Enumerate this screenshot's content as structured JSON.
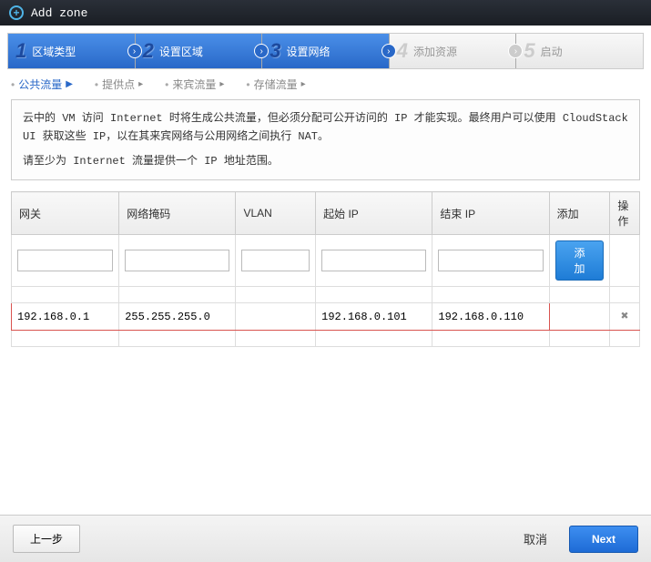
{
  "title": "Add zone",
  "steps": [
    {
      "num": "1",
      "label": "区域类型",
      "active": true
    },
    {
      "num": "2",
      "label": "设置区域",
      "active": true
    },
    {
      "num": "3",
      "label": "设置网络",
      "active": true
    },
    {
      "num": "4",
      "label": "添加资源",
      "active": false
    },
    {
      "num": "5",
      "label": "启动",
      "active": false
    }
  ],
  "subnav": {
    "public": "公共流量",
    "pod": "提供点",
    "guest": "来宾流量",
    "storage": "存储流量"
  },
  "info_line1": "云中的 VM 访问 Internet 时将生成公共流量，但必须分配可公开访问的 IP 才能实现。最终用户可以使用 CloudStack UI 获取这些 IP，以在其来宾网络与公用网络之间执行 NAT。",
  "info_line2": "请至少为 Internet 流量提供一个 IP 地址范围。",
  "headers": {
    "gateway": "网关",
    "netmask": "网络掩码",
    "vlan": "VLAN",
    "startip": "起始 IP",
    "endip": "结束 IP",
    "add": "添加",
    "ops": "操作"
  },
  "add_btn": "添加",
  "row": {
    "gateway": "192.168.0.1",
    "netmask": "255.255.255.0",
    "vlan": "",
    "startip": "192.168.0.101",
    "endip": "192.168.0.110"
  },
  "footer": {
    "prev": "上一步",
    "cancel": "取消",
    "next": "Next"
  }
}
